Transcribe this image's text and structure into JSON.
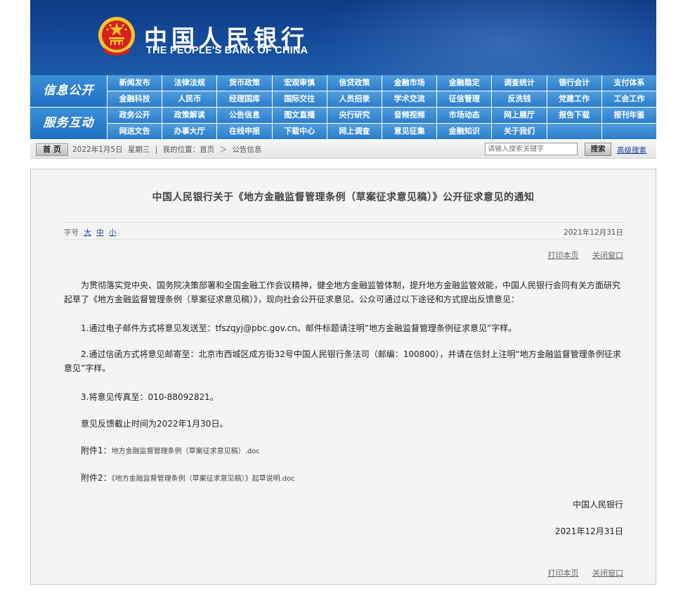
{
  "header": {
    "logo_cn": "中国人民银行",
    "logo_en": "THE PEOPLE'S BANK OF CHINA",
    "emblem": "national-emblem-icon",
    "colors": {
      "banner": "#164b9c",
      "emblem_red": "#d8201c",
      "emblem_gold": "#f4c430"
    }
  },
  "nav": {
    "info": {
      "label": "信息公开",
      "items": [
        "新闻发布",
        "法律法规",
        "货币政策",
        "宏观审慎",
        "信贷政策",
        "金融市场",
        "金融稳定",
        "调查统计",
        "银行会计",
        "支付体系",
        "金融科技",
        "人民币",
        "经理国库",
        "国际交往",
        "人员招录",
        "学术交流",
        "征信管理",
        "反洗钱",
        "党建工作",
        "工会工作"
      ]
    },
    "service": {
      "label": "服务互动",
      "items": [
        "政务公开",
        "政策解读",
        "公告信息",
        "图文直播",
        "央行研究",
        "音频视频",
        "市场动态",
        "网上展厅",
        "报告下载",
        "报刊年鉴",
        "网送文告",
        "办事大厅",
        "在线申报",
        "下载中心",
        "网上调查",
        "意见征集",
        "金融知识",
        "关于我们",
        "",
        ""
      ]
    },
    "colors": {
      "item": "#2c7cc9",
      "category": "#1f6fc2"
    }
  },
  "statusbar": {
    "home": "首 页",
    "date": "2022年1月5日",
    "weekday": "星期三",
    "sep": "|",
    "location_label": "我的位置：首页",
    "arrow": "＞",
    "location_current": "公告信息",
    "search_placeholder": "请输入搜索关键字",
    "search_button": "搜索",
    "advanced_search": "高级搜索"
  },
  "article": {
    "title": "中国人民银行关于《地方金融监督管理条例（草案征求意见稿）》公开征求意见的通知",
    "fontsize_label": "字号",
    "fontsize_large": "大",
    "fontsize_medium": "中",
    "fontsize_small": "小",
    "date": "2021年12月31日",
    "print": "打印本页",
    "close": "关闭窗口",
    "para1": "为贯彻落实党中央、国务院决策部署和全国金融工作会议精神，健全地方金融监管体制，提升地方金融监管效能，中国人民银行会同有关方面研究起草了《地方金融监督管理条例（草案征求意见稿）》，现向社会公开征求意见。公众可通过以下途径和方式提出反馈意见：",
    "para2": "1.通过电子邮件方式将意见发送至：tfszqyj@pbc.gov.cn。邮件标题请注明“地方金融监督管理条例征求意见”字样。",
    "para3": "2.通过信函方式将意见邮寄至：北京市西城区成方街32号中国人民银行条法司（邮编：100800），并请在信封上注明“地方金融监督管理条例征求意见”字样。",
    "para4": "3.将意见传真至：010-88092821。",
    "para5": "意见反馈截止时间为2022年1月30日。",
    "attach1_label": "附件1：",
    "attach1_file": "地方金融监督管理条例（草案征求意见稿）.doc",
    "attach2_label": "附件2：",
    "attach2_file": "《地方金融监督管理条例（草案征求意见稿）》起草说明.doc",
    "sign_org": "中国人民银行",
    "sign_date": "2021年12月31日",
    "print_bottom": "打印本页",
    "close_bottom": "关闭窗口"
  }
}
